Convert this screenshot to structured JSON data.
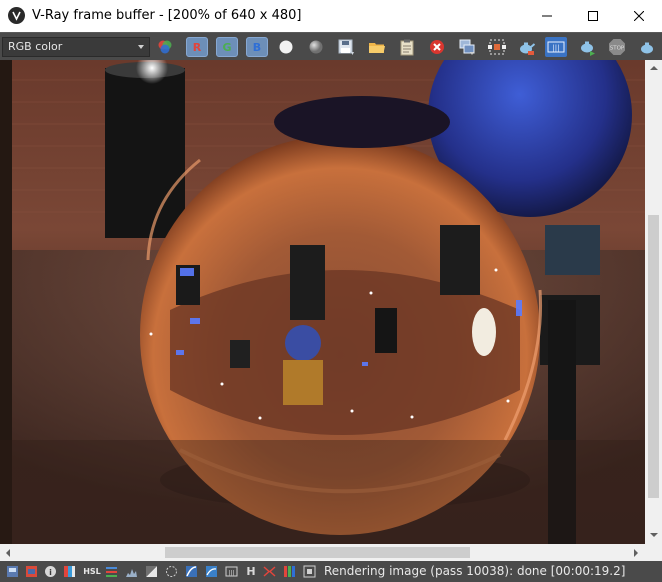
{
  "window": {
    "title": "V-Ray frame buffer - [200% of 640 x 480]",
    "icons": [
      "vray-logo-icon",
      "minimize-icon",
      "maximize-icon",
      "close-icon"
    ]
  },
  "toolbar": {
    "channel_select": "RGB color",
    "channel_r": "R",
    "channel_g": "G",
    "channel_b": "B",
    "icons": [
      "color-channels-icon",
      "white-sphere-icon",
      "gray-sphere-icon",
      "save-icon",
      "open-folder-icon",
      "clipboard-icon",
      "clear-icon",
      "duplicate-icon",
      "region-icon",
      "teapot-icon",
      "link-icon",
      "render-teapot-icon",
      "stop-icon",
      "teapot-small-icon"
    ]
  },
  "viewport": {
    "description_icons": [
      "render-image"
    ]
  },
  "statusbar": {
    "status": "Rendering image (pass 10038): done [00:00:19.2]",
    "label_hsl": "HSL",
    "label_h": "H",
    "label_info": "i"
  },
  "colors": {
    "toolbar_bg": "#4a4a4a",
    "channel_button": "#6d8fb8",
    "red": "#e2453c",
    "green": "#4caf50",
    "blue": "#2f6fd6"
  }
}
